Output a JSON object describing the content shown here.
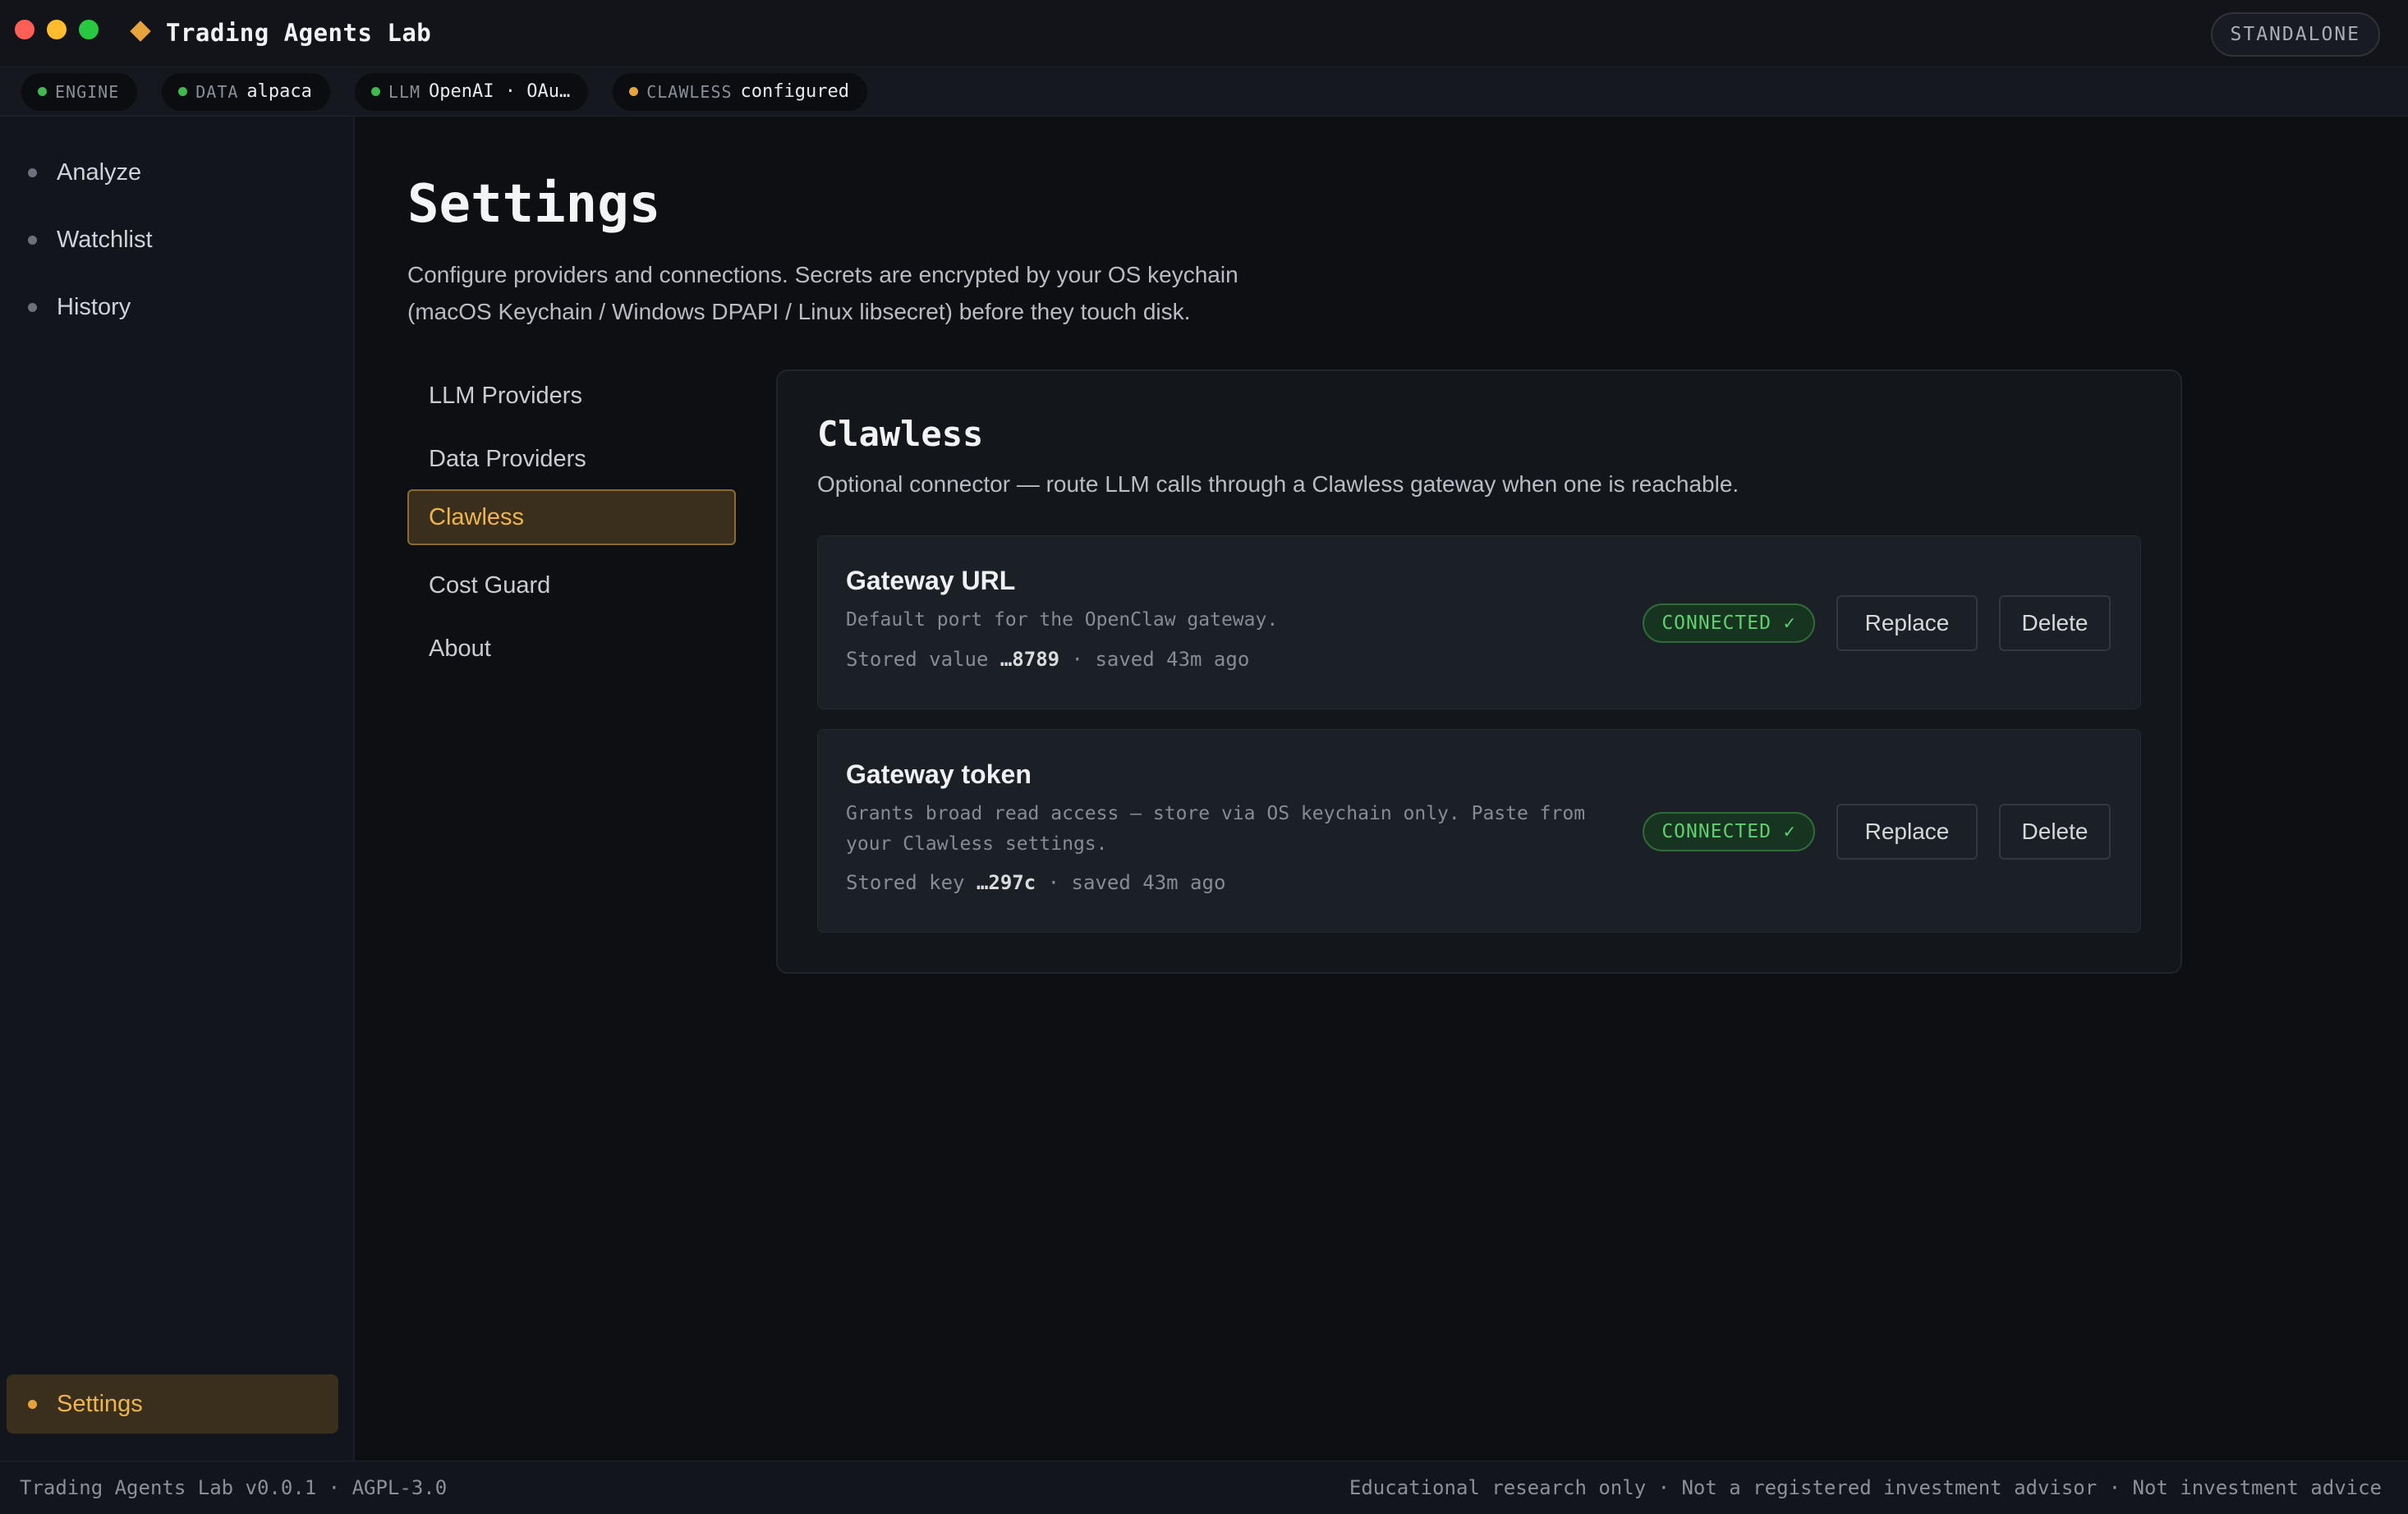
{
  "app": {
    "title": "Trading Agents Lab",
    "mode": "STANDALONE",
    "accent": "#e8a33d"
  },
  "status": {
    "engine": {
      "key": "ENGINE",
      "value": "",
      "color": "#3fb950"
    },
    "data": {
      "key": "DATA",
      "value": "alpaca",
      "color": "#3fb950"
    },
    "llm": {
      "key": "LLM",
      "value": "OpenAI · OAu…",
      "color": "#3fb950"
    },
    "clawless": {
      "key": "CLAWLESS",
      "value": "configured",
      "color": "#e8a33d"
    }
  },
  "sidebar": {
    "items": [
      {
        "label": "Analyze"
      },
      {
        "label": "Watchlist"
      },
      {
        "label": "History"
      }
    ],
    "settings_label": "Settings"
  },
  "page": {
    "title": "Settings",
    "description_line1": "Configure providers and connections. Secrets are encrypted by your OS keychain",
    "description_line2": "(macOS Keychain / Windows DPAPI / Linux libsecret) before they touch disk."
  },
  "subnav": {
    "items": [
      {
        "label": "LLM Providers"
      },
      {
        "label": "Data Providers"
      },
      {
        "label": "Clawless",
        "active": true
      },
      {
        "label": "Cost Guard"
      },
      {
        "label": "About"
      }
    ]
  },
  "panel": {
    "title": "Clawless",
    "description": "Optional connector — route LLM calls through a Clawless gateway when one is reachable.",
    "credentials": [
      {
        "name": "Gateway URL",
        "help": "Default port for the OpenClaw gateway.",
        "meta_prefix": "Stored value ",
        "meta_value": "…8789",
        "meta_suffix": " · saved 43m ago",
        "status": "CONNECTED ✓",
        "replace_label": "Replace",
        "delete_label": "Delete"
      },
      {
        "name": "Gateway token",
        "help": "Grants broad read access — store via OS keychain only. Paste from your Clawless settings.",
        "meta_prefix": "Stored key ",
        "meta_value": "…297c",
        "meta_suffix": " · saved 43m ago",
        "status": "CONNECTED ✓",
        "replace_label": "Replace",
        "delete_label": "Delete"
      }
    ]
  },
  "footer": {
    "left": "Trading Agents Lab v0.0.1 · AGPL-3.0",
    "right": "Educational research only · Not a registered investment advisor · Not investment advice"
  }
}
